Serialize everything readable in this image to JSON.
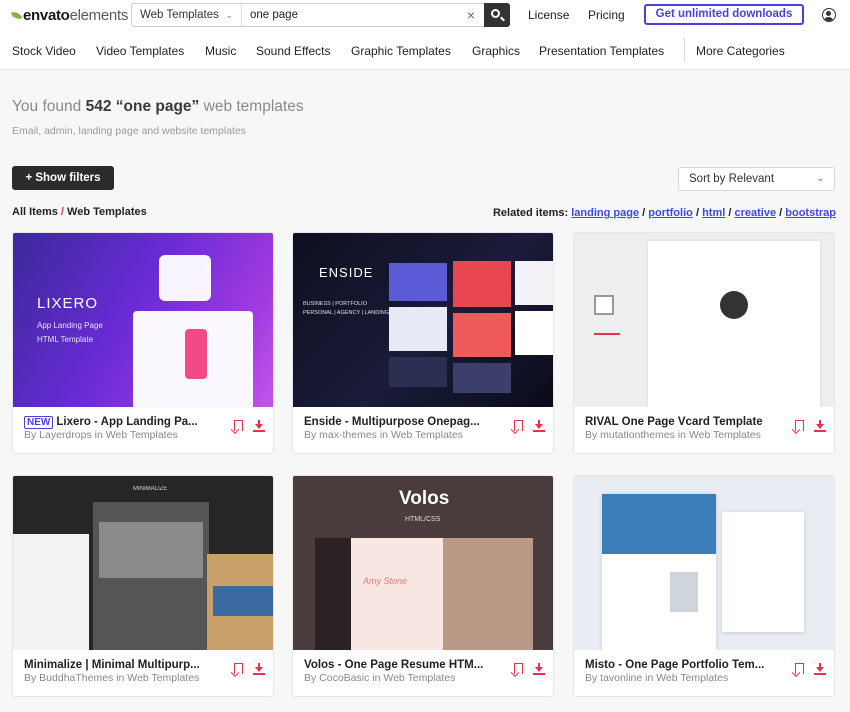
{
  "brand": {
    "logo_main": "envato",
    "logo_sub": "elements"
  },
  "search": {
    "category": "Web Templates",
    "query": "one page"
  },
  "header_links": {
    "license": "License",
    "pricing": "Pricing",
    "cta": "Get unlimited downloads"
  },
  "categories": [
    "Stock Video",
    "Video Templates",
    "Music",
    "Sound Effects",
    "Graphic Templates",
    "Graphics",
    "Presentation Templates",
    "More Categories"
  ],
  "results": {
    "prefix": "You found",
    "count": "542",
    "query": "“one page”",
    "suffix": "web templates",
    "subtitle": "Email, admin, landing page and website templates"
  },
  "toolbar": {
    "filters": "+ Show filters",
    "sort": "Sort by Relevant"
  },
  "breadcrumb": {
    "root": "All Items",
    "sep": "/",
    "current": "Web Templates"
  },
  "related": {
    "label": "Related items:",
    "items": [
      "landing page",
      "portfolio",
      "html",
      "creative",
      "bootstrap"
    ],
    "sep": "/"
  },
  "cards": [
    {
      "badge": "NEW",
      "title": "Lixero - App Landing Pa...",
      "author": "By Layerdrops in Web Templates",
      "thumb_text": "LIXERO",
      "thumb_sub": "App Landing Page",
      "thumb_sub2": "HTML Template"
    },
    {
      "badge": "",
      "title": "Enside - Multipurpose Onepag...",
      "author": "By max-themes in Web Templates",
      "thumb_text": "ENSIDE",
      "thumb_sub": "BUSINESS | PORTFOLIO",
      "thumb_sub2": "PERSONAL | AGENCY | LANDING"
    },
    {
      "badge": "",
      "title": "RIVAL One Page Vcard Template",
      "author": "By mutationthemes in Web Templates",
      "thumb_text": "",
      "thumb_sub": "",
      "thumb_sub2": ""
    },
    {
      "badge": "",
      "title": "Minimalize | Minimal Multipurp...",
      "author": "By BuddhaThemes in Web Templates",
      "thumb_text": "MINIMALIZE",
      "thumb_sub": "",
      "thumb_sub2": ""
    },
    {
      "badge": "",
      "title": "Volos - One Page Resume HTM...",
      "author": "By CocoBasic in Web Templates",
      "thumb_text": "Volos",
      "thumb_sub": "HTML/CSS",
      "thumb_sub2": "Amy Stone"
    },
    {
      "badge": "",
      "title": "Misto - One Page Portfolio Tem...",
      "author": "By tavonline in Web Templates",
      "thumb_text": "",
      "thumb_sub": "",
      "thumb_sub2": ""
    }
  ],
  "colors": {
    "accent": "#4c3fe0",
    "brand_green": "#82b541",
    "action_red": "#e8314f",
    "dark": "#2b2b2b"
  }
}
